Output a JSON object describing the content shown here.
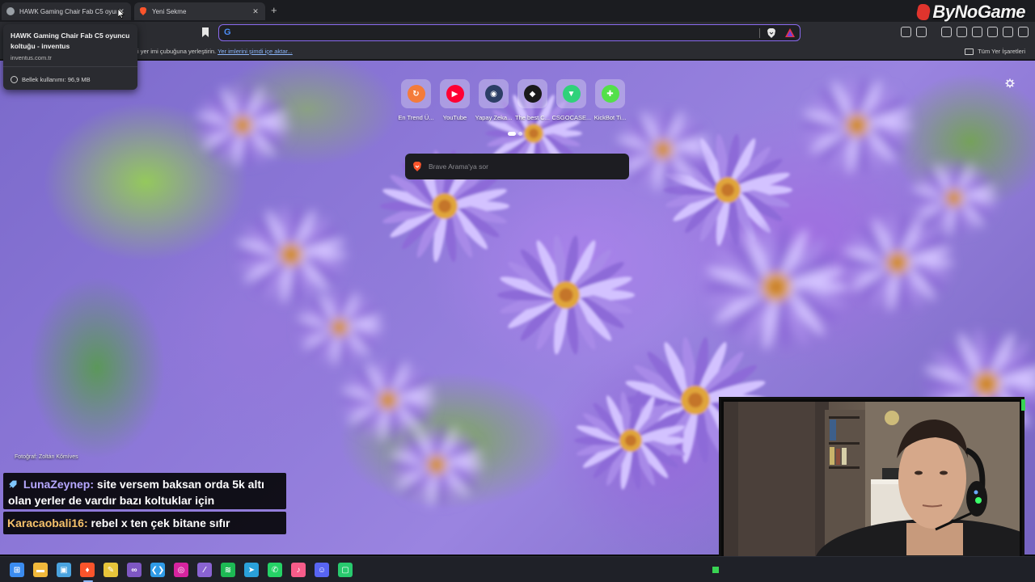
{
  "browser": {
    "tabs": [
      {
        "title": "HAWK Gaming Chair Fab C5 oyuncu koltuğu - inventus",
        "active": false
      },
      {
        "title": "Yeni Sekme",
        "active": true
      }
    ],
    "new_tab_symbol": "+",
    "close_symbol": "✕",
    "brand": "ByNoGame",
    "omnibox": {
      "value": "",
      "placeholder": ""
    },
    "bookmarks_bar": {
      "hint_text": "i yer imi çubuğuna yerleştirin.",
      "import_link": "Yer imlerini şimdi içe aktar...",
      "all_bookmarks": "Tüm Yer İşaretleri"
    }
  },
  "tooltip": {
    "title": "HAWK Gaming Chair Fab C5 oyuncu koltuğu - inventus",
    "domain": "inventus.com.tr",
    "memory": "Bellek kullanımı: 96,9 MB"
  },
  "new_tab_page": {
    "shortcuts": [
      {
        "label": "En Trend Ü...",
        "icon": "trend-icon",
        "color": "#f47b3a",
        "glyph": "↻"
      },
      {
        "label": "YouTube",
        "icon": "youtube-icon",
        "color": "#ff0033",
        "glyph": "▶"
      },
      {
        "label": "Yapay Zeka...",
        "icon": "ai-robot-icon",
        "color": "#2c3e66",
        "glyph": "◉"
      },
      {
        "label": "The best C...",
        "icon": "box-icon",
        "color": "#1a1a1a",
        "glyph": "◆"
      },
      {
        "label": "CSGOCASE...",
        "icon": "csgocase-icon",
        "color": "#2fd27a",
        "glyph": "▼"
      },
      {
        "label": "KickBot Ti...",
        "icon": "kickbot-icon",
        "color": "#53e04a",
        "glyph": "✚"
      }
    ],
    "search_placeholder": "Brave Arama'ya sor",
    "photo_credit": "Fotoğraf: Zoltán Kőmíves"
  },
  "chat": [
    {
      "user": "LunaZeynep:",
      "message": "site versem baksan orda 5k altı olan yerler de vardır bazı koltuklar için"
    },
    {
      "user": "Karacaobali16:",
      "message": "rebel x ten çek bitane sıfır"
    }
  ],
  "taskbar": {
    "apps": [
      {
        "name": "windows-start-icon",
        "color": "#3b8cf0",
        "glyph": "⊞"
      },
      {
        "name": "file-explorer-icon",
        "color": "#f1b93b",
        "glyph": "▬"
      },
      {
        "name": "photos-icon",
        "color": "#4aa3df",
        "glyph": "▣"
      },
      {
        "name": "brave-browser-icon",
        "color": "#fb542b",
        "glyph": "♦"
      },
      {
        "name": "app-pinned-icon",
        "color": "#e7c43a",
        "glyph": "✎"
      },
      {
        "name": "visual-studio-icon",
        "color": "#7e57c2",
        "glyph": "∞"
      },
      {
        "name": "vscode-icon",
        "color": "#2f9be6",
        "glyph": "❮❯"
      },
      {
        "name": "instagram-icon",
        "color": "#d6249f",
        "glyph": "◎"
      },
      {
        "name": "feather-app-icon",
        "color": "#8a63d2",
        "glyph": "⁄"
      },
      {
        "name": "spotify-icon",
        "color": "#1db954",
        "glyph": "≋"
      },
      {
        "name": "telegram-icon",
        "color": "#2aa1da",
        "glyph": "➤"
      },
      {
        "name": "whatsapp-icon",
        "color": "#25d366",
        "glyph": "✆"
      },
      {
        "name": "itunes-icon",
        "color": "#f85c8a",
        "glyph": "♪"
      },
      {
        "name": "discord-icon",
        "color": "#5865f2",
        "glyph": "☺"
      },
      {
        "name": "streaming-app-icon",
        "color": "#28c96e",
        "glyph": "▢"
      }
    ]
  }
}
